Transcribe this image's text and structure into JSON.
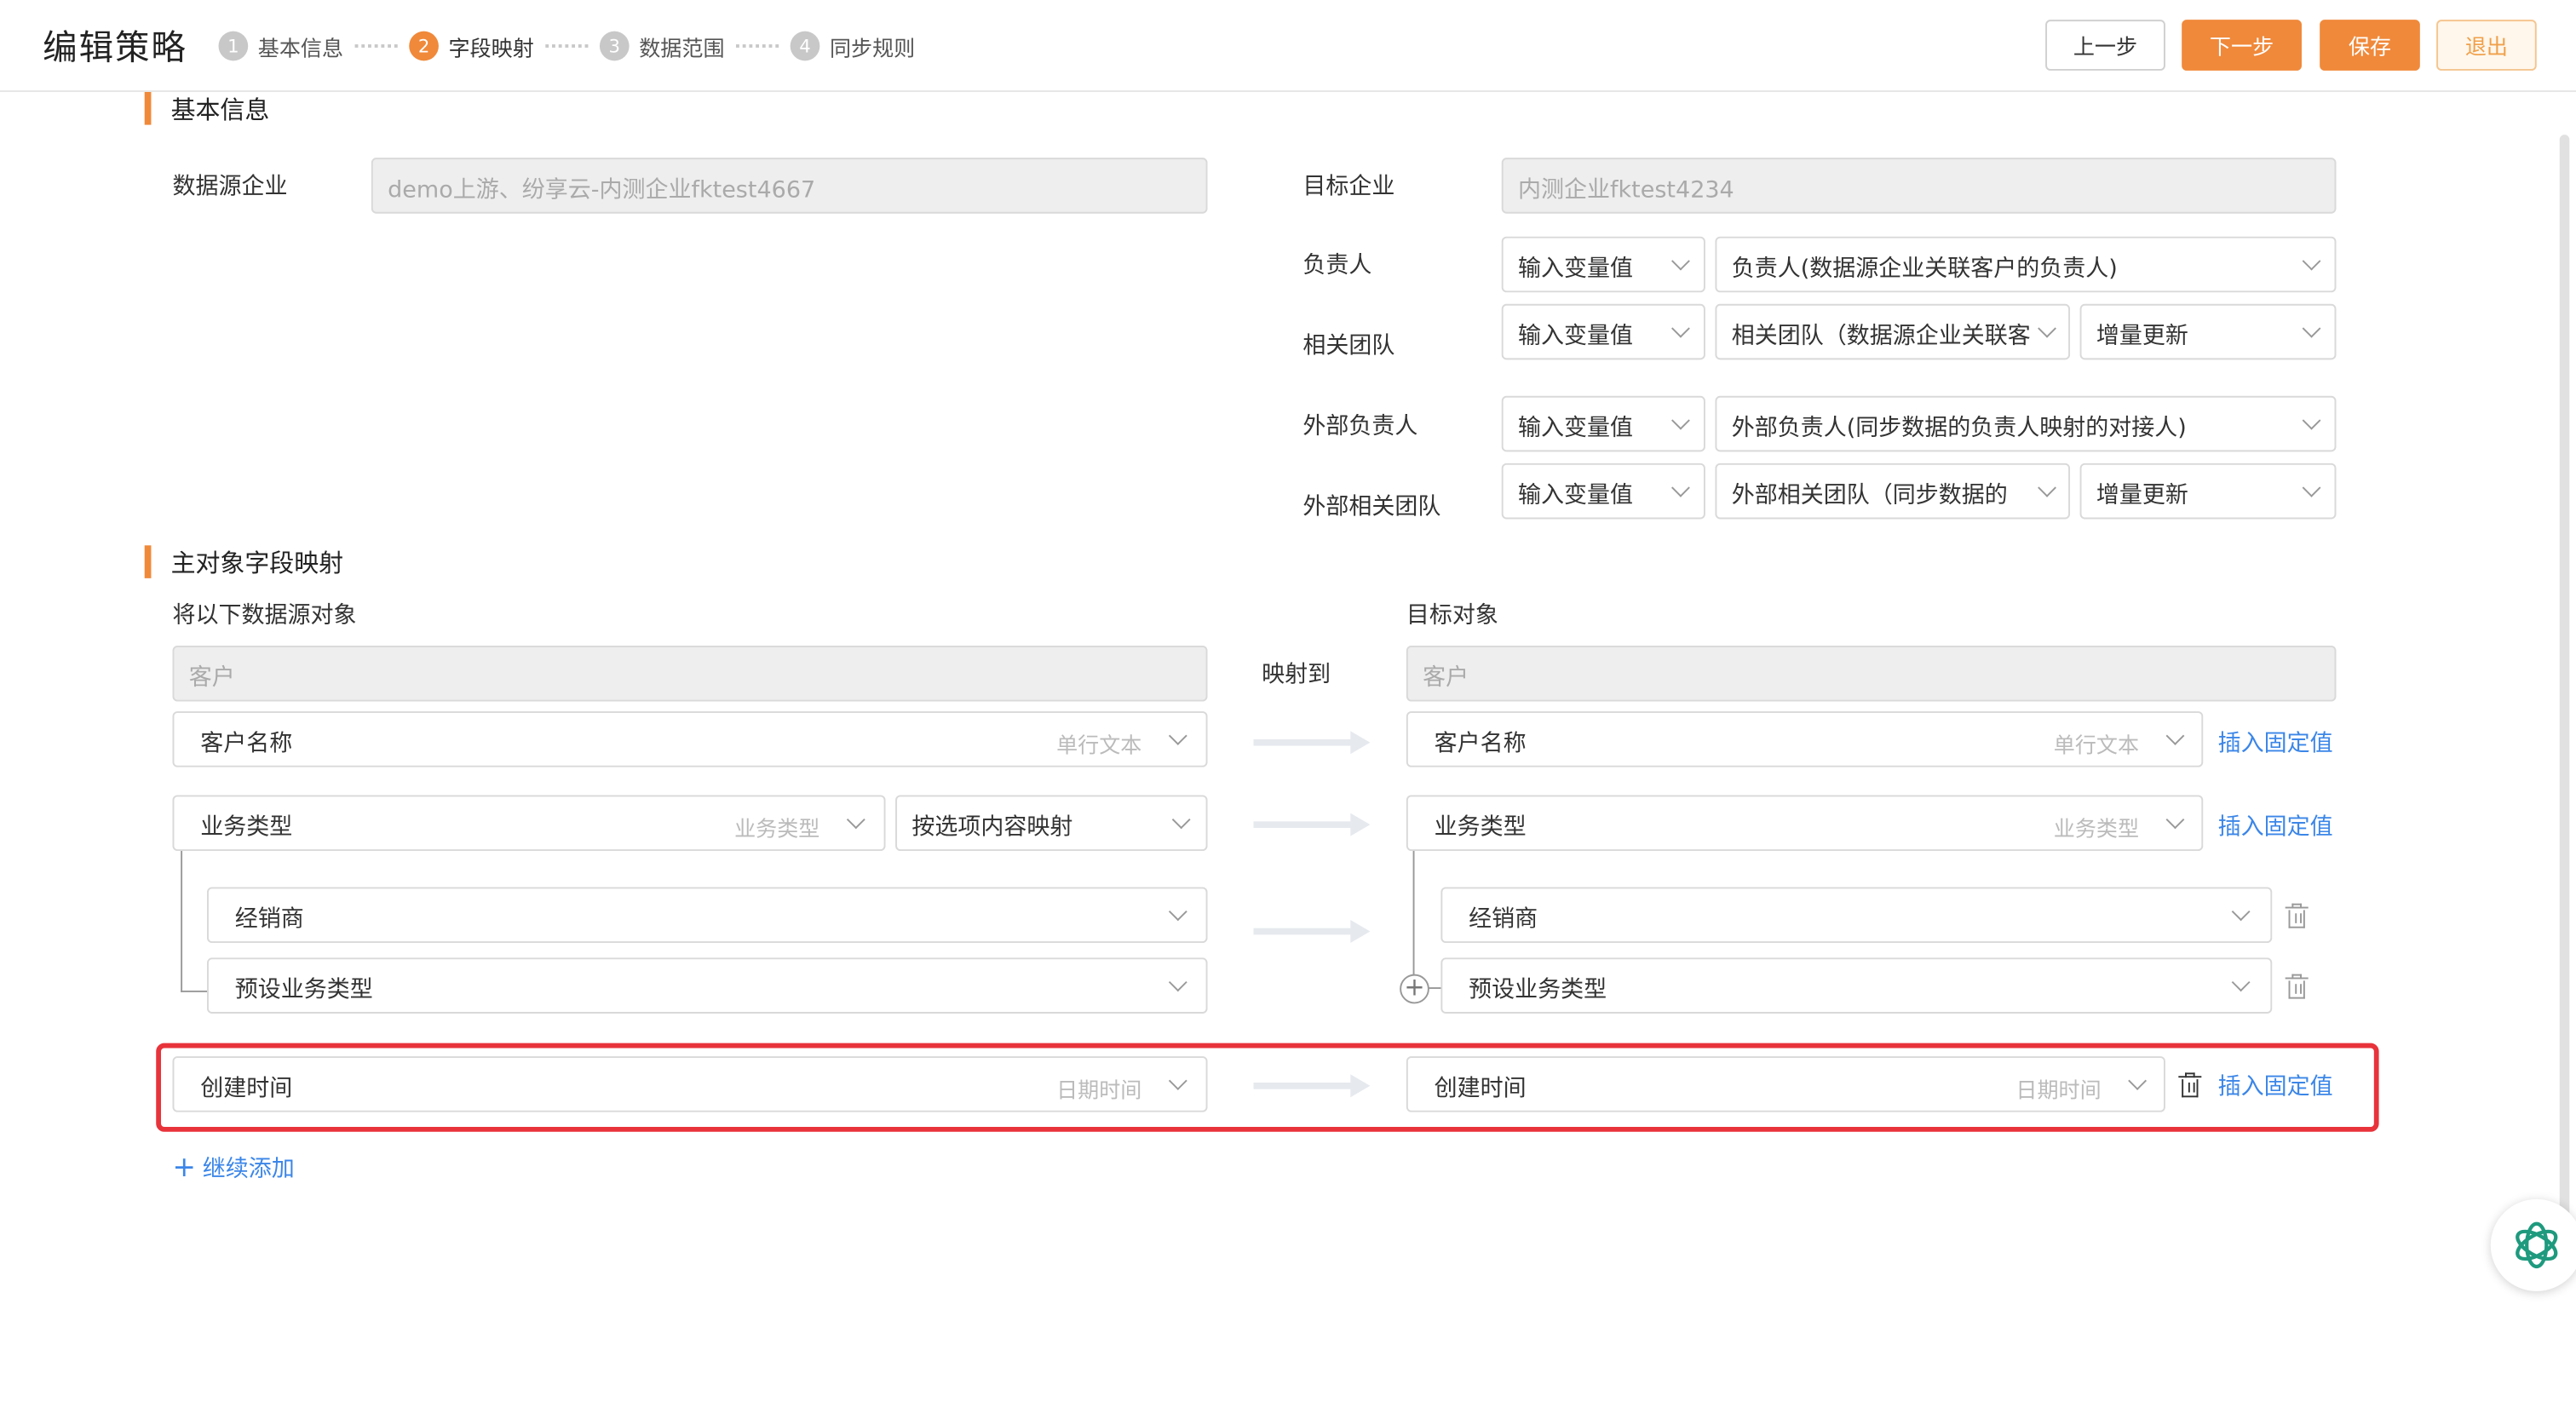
{
  "header": {
    "title": "编辑策略",
    "steps": [
      {
        "num": "1",
        "label": "基本信息"
      },
      {
        "num": "2",
        "label": "字段映射"
      },
      {
        "num": "3",
        "label": "数据范围"
      },
      {
        "num": "4",
        "label": "同步规则"
      }
    ],
    "buttons": {
      "prev": "上一步",
      "next": "下一步",
      "save": "保存",
      "exit": "退出"
    }
  },
  "basic_info": {
    "section_title": "基本信息",
    "source_company_label": "数据源企业",
    "source_company_value": "demo上游、纷享云-内测企业fktest4667",
    "target_company_label": "目标企业",
    "target_company_value": "内测企业fktest4234",
    "owner_label": "负责人",
    "owner_mode": "输入变量值",
    "owner_value": "负责人(数据源企业关联客户的负责人)",
    "team_label": "相关团队",
    "team_mode": "输入变量值",
    "team_value": "相关团队（数据源企业关联客",
    "team_update": "增量更新",
    "ext_owner_label": "外部负责人",
    "ext_owner_mode": "输入变量值",
    "ext_owner_value": "外部负责人(同步数据的负责人映射的对接人)",
    "ext_team_label": "外部相关团队",
    "ext_team_mode": "输入变量值",
    "ext_team_value": "外部相关团队（同步数据的",
    "ext_team_update": "增量更新"
  },
  "mapping": {
    "section_title": "主对象字段映射",
    "source_label": "将以下数据源对象",
    "target_label": "目标对象",
    "map_to_label": "映射到",
    "source_object": "客户",
    "target_object": "客户",
    "insert_fixed": "插入固定值",
    "rows": {
      "name": {
        "source": "客户名称",
        "source_type": "单行文本",
        "target": "客户名称",
        "target_type": "单行文本"
      },
      "biz": {
        "source": "业务类型",
        "source_type": "业务类型",
        "mode": "按选项内容映射",
        "target": "业务类型",
        "target_type": "业务类型"
      },
      "opt1": {
        "source": "经销商",
        "target": "经销商"
      },
      "opt2": {
        "source": "预设业务类型",
        "target": "预设业务类型"
      },
      "created": {
        "source": "创建时间",
        "source_type": "日期时间",
        "target": "创建时间",
        "target_type": "日期时间"
      }
    },
    "add_more": "继续添加"
  },
  "colors": {
    "accent": "#f0893a",
    "link": "#3b86e8",
    "highlight": "#e8333b"
  }
}
